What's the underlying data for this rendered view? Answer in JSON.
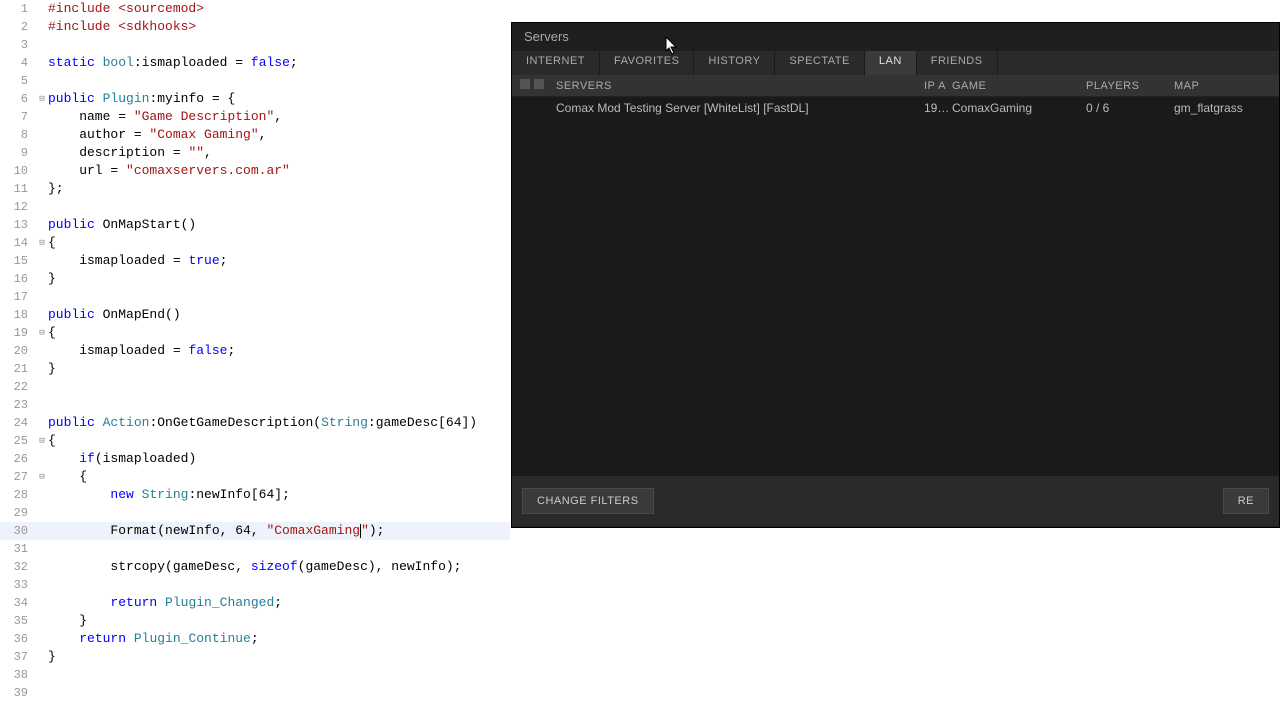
{
  "code_lines": [
    {
      "n": 1,
      "fold": "",
      "seg": [
        {
          "t": "#include <sourcemod>",
          "c": "str"
        }
      ]
    },
    {
      "n": 2,
      "fold": "",
      "seg": [
        {
          "t": "#include <sdkhooks>",
          "c": "str"
        }
      ]
    },
    {
      "n": 3,
      "fold": "",
      "seg": []
    },
    {
      "n": 4,
      "fold": "",
      "seg": [
        {
          "t": "static",
          "c": "kw"
        },
        {
          "t": " "
        },
        {
          "t": "bool",
          "c": "type"
        },
        {
          "t": ":"
        },
        {
          "t": "ismaploaded"
        },
        {
          "t": " = "
        },
        {
          "t": "false",
          "c": "const"
        },
        {
          "t": ";"
        }
      ]
    },
    {
      "n": 5,
      "fold": "",
      "seg": []
    },
    {
      "n": 6,
      "fold": "⊟",
      "seg": [
        {
          "t": "public",
          "c": "kw"
        },
        {
          "t": " "
        },
        {
          "t": "Plugin",
          "c": "type"
        },
        {
          "t": ":myinfo = {"
        }
      ]
    },
    {
      "n": 7,
      "fold": "",
      "seg": [
        {
          "t": "    name = "
        },
        {
          "t": "\"Game Description\"",
          "c": "str"
        },
        {
          "t": ","
        }
      ]
    },
    {
      "n": 8,
      "fold": "",
      "seg": [
        {
          "t": "    author = "
        },
        {
          "t": "\"Comax Gaming\"",
          "c": "str"
        },
        {
          "t": ","
        }
      ]
    },
    {
      "n": 9,
      "fold": "",
      "seg": [
        {
          "t": "    description = "
        },
        {
          "t": "\"\"",
          "c": "str"
        },
        {
          "t": ","
        }
      ]
    },
    {
      "n": 10,
      "fold": "",
      "seg": [
        {
          "t": "    url = "
        },
        {
          "t": "\"comaxservers.com.ar\"",
          "c": "str"
        }
      ]
    },
    {
      "n": 11,
      "fold": "",
      "seg": [
        {
          "t": "};"
        }
      ]
    },
    {
      "n": 12,
      "fold": "",
      "seg": []
    },
    {
      "n": 13,
      "fold": "",
      "seg": [
        {
          "t": "public",
          "c": "kw"
        },
        {
          "t": " OnMapStart()"
        }
      ]
    },
    {
      "n": 14,
      "fold": "⊟",
      "seg": [
        {
          "t": "{"
        }
      ]
    },
    {
      "n": 15,
      "fold": "",
      "seg": [
        {
          "t": "    ismaploaded = "
        },
        {
          "t": "true",
          "c": "const"
        },
        {
          "t": ";"
        }
      ]
    },
    {
      "n": 16,
      "fold": "",
      "seg": [
        {
          "t": "}"
        }
      ]
    },
    {
      "n": 17,
      "fold": "",
      "seg": []
    },
    {
      "n": 18,
      "fold": "",
      "seg": [
        {
          "t": "public",
          "c": "kw"
        },
        {
          "t": " OnMapEnd()"
        }
      ]
    },
    {
      "n": 19,
      "fold": "⊟",
      "seg": [
        {
          "t": "{"
        }
      ]
    },
    {
      "n": 20,
      "fold": "",
      "seg": [
        {
          "t": "    ismaploaded = "
        },
        {
          "t": "false",
          "c": "const"
        },
        {
          "t": ";"
        }
      ]
    },
    {
      "n": 21,
      "fold": "",
      "seg": [
        {
          "t": "}"
        }
      ]
    },
    {
      "n": 22,
      "fold": "",
      "seg": []
    },
    {
      "n": 23,
      "fold": "",
      "seg": []
    },
    {
      "n": 24,
      "fold": "",
      "seg": [
        {
          "t": "public",
          "c": "kw"
        },
        {
          "t": " "
        },
        {
          "t": "Action",
          "c": "ident"
        },
        {
          "t": ":OnGetGameDescription("
        },
        {
          "t": "String",
          "c": "type"
        },
        {
          "t": ":gameDesc[64])"
        }
      ]
    },
    {
      "n": 25,
      "fold": "⊟",
      "seg": [
        {
          "t": "{"
        }
      ]
    },
    {
      "n": 26,
      "fold": "",
      "seg": [
        {
          "t": "    "
        },
        {
          "t": "if",
          "c": "kw"
        },
        {
          "t": "(ismaploaded)"
        }
      ]
    },
    {
      "n": 27,
      "fold": "⊟",
      "seg": [
        {
          "t": "    {"
        }
      ]
    },
    {
      "n": 28,
      "fold": "",
      "seg": [
        {
          "t": "        "
        },
        {
          "t": "new",
          "c": "kw"
        },
        {
          "t": " "
        },
        {
          "t": "String",
          "c": "type"
        },
        {
          "t": ":newInfo[64];"
        }
      ]
    },
    {
      "n": 29,
      "fold": "",
      "seg": []
    },
    {
      "n": 30,
      "fold": "",
      "hl": true,
      "seg": [
        {
          "t": "        Format(newInfo, 64, "
        },
        {
          "t": "\"ComaxGaming",
          "c": "str"
        },
        {
          "t": "",
          "caret": true
        },
        {
          "t": "\"",
          "c": "str"
        },
        {
          "t": ");"
        }
      ]
    },
    {
      "n": 31,
      "fold": "",
      "seg": []
    },
    {
      "n": 32,
      "fold": "",
      "seg": [
        {
          "t": "        strcopy(gameDesc, "
        },
        {
          "t": "sizeof",
          "c": "kw"
        },
        {
          "t": "(gameDesc), newInfo);"
        }
      ]
    },
    {
      "n": 33,
      "fold": "",
      "seg": []
    },
    {
      "n": 34,
      "fold": "",
      "seg": [
        {
          "t": "        "
        },
        {
          "t": "return",
          "c": "kw"
        },
        {
          "t": " "
        },
        {
          "t": "Plugin_Changed",
          "c": "ident"
        },
        {
          "t": ";"
        }
      ]
    },
    {
      "n": 35,
      "fold": "",
      "seg": [
        {
          "t": "    }"
        }
      ]
    },
    {
      "n": 36,
      "fold": "",
      "seg": [
        {
          "t": "    "
        },
        {
          "t": "return",
          "c": "kw"
        },
        {
          "t": " "
        },
        {
          "t": "Plugin_Continue",
          "c": "ident"
        },
        {
          "t": ";"
        }
      ]
    },
    {
      "n": 37,
      "fold": "",
      "seg": [
        {
          "t": "}"
        }
      ]
    },
    {
      "n": 38,
      "fold": "",
      "seg": []
    },
    {
      "n": 39,
      "fold": "",
      "seg": []
    }
  ],
  "servers": {
    "title": "Servers",
    "tabs": [
      "INTERNET",
      "FAVORITES",
      "HISTORY",
      "SPECTATE",
      "LAN",
      "FRIENDS"
    ],
    "active_tab": 4,
    "headers": {
      "servers": "SERVERS",
      "ip": "IP A",
      "game": "GAME",
      "players": "PLAYERS",
      "map": "MAP"
    },
    "rows": [
      {
        "name": "Comax Mod Testing Server [WhiteList] [FastDL]",
        "ip": "19…",
        "game": "ComaxGaming",
        "players": "0 / 6",
        "map": "gm_flatgrass"
      }
    ],
    "change_filters": "CHANGE FILTERS",
    "refresh": "RE"
  }
}
